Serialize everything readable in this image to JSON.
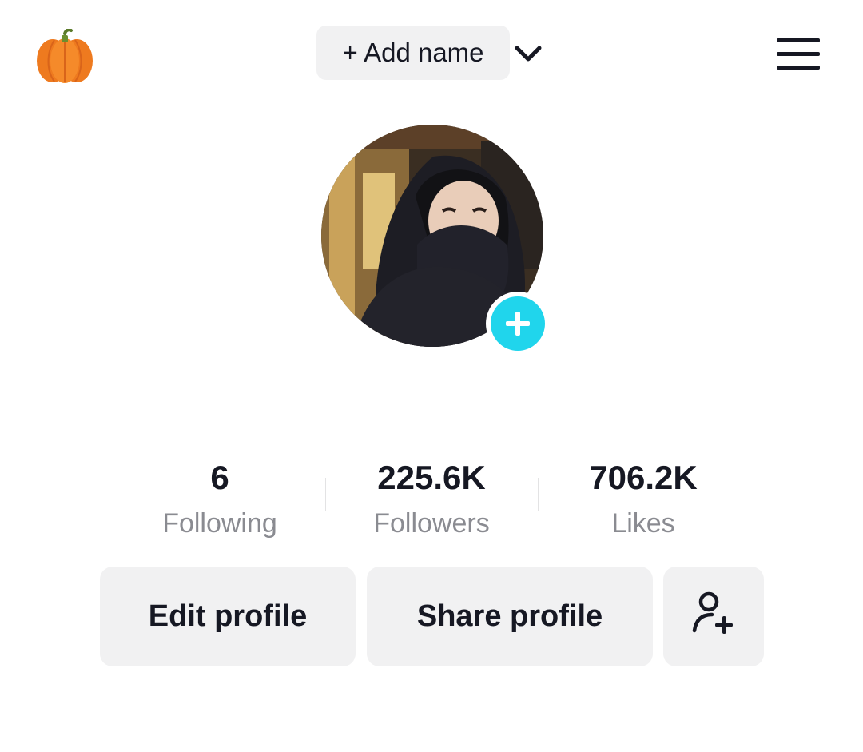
{
  "header": {
    "emoji_icon": "pumpkin-icon",
    "add_name_label": "+ Add name",
    "dropdown_icon": "chevron-down-icon",
    "menu_icon": "hamburger-menu-icon"
  },
  "avatar": {
    "add_badge_icon": "plus-icon",
    "badge_color": "#20d5ec"
  },
  "stats": [
    {
      "value": "6",
      "label": "Following"
    },
    {
      "value": "225.6K",
      "label": "Followers"
    },
    {
      "value": "706.2K",
      "label": "Likes"
    }
  ],
  "actions": {
    "edit_label": "Edit profile",
    "share_label": "Share profile",
    "add_friend_icon": "add-user-icon"
  }
}
